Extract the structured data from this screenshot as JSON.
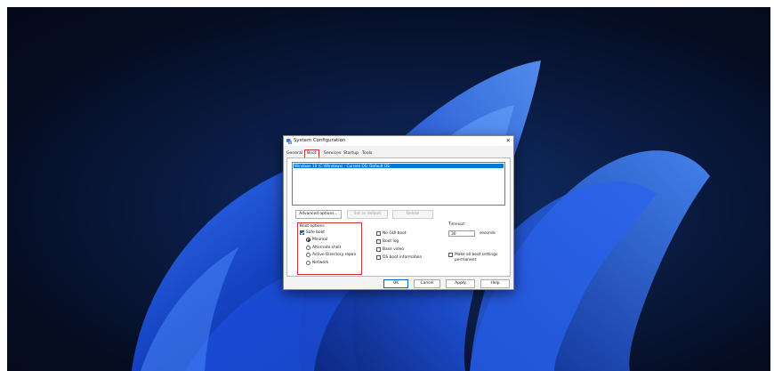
{
  "dialog": {
    "title": "System Configuration",
    "close_glyph": "✕",
    "icon": "system-config-icon"
  },
  "tabs": [
    {
      "label": "General",
      "active": false
    },
    {
      "label": "Boot",
      "active": true
    },
    {
      "label": "Services",
      "active": false
    },
    {
      "label": "Startup",
      "active": false
    },
    {
      "label": "Tools",
      "active": false
    }
  ],
  "boot": {
    "os_entries": [
      "Windows 10 (C:\\Windows) : Current OS; Default OS"
    ],
    "buttons": {
      "advanced": "Advanced options...",
      "set_default": "Set as default",
      "delete": "Delete"
    },
    "boot_options": {
      "title": "Boot options",
      "safe_boot": {
        "label": "Safe boot",
        "checked": true
      },
      "modes": [
        {
          "label": "Minimal",
          "checked": true
        },
        {
          "label": "Alternate shell",
          "checked": false
        },
        {
          "label": "Active Directory repair",
          "checked": false
        },
        {
          "label": "Network",
          "checked": false
        }
      ],
      "flags": [
        {
          "label": "No GUI boot",
          "checked": false
        },
        {
          "label": "Boot log",
          "checked": false
        },
        {
          "label": "Base video",
          "checked": false
        },
        {
          "label": "OS boot information",
          "checked": false
        }
      ]
    },
    "timeout": {
      "label": "Timeout:",
      "value": "30",
      "unit": "seconds"
    },
    "permanent": {
      "label_line1": "Make all boot settings",
      "label_line2": "permanent",
      "checked": false
    }
  },
  "footer": {
    "ok": "OK",
    "cancel": "Cancel",
    "apply": "Apply",
    "help": "Help"
  },
  "colors": {
    "accent": "#0067c0",
    "selection": "#0078d7",
    "highlight_box": "#cc3333"
  }
}
